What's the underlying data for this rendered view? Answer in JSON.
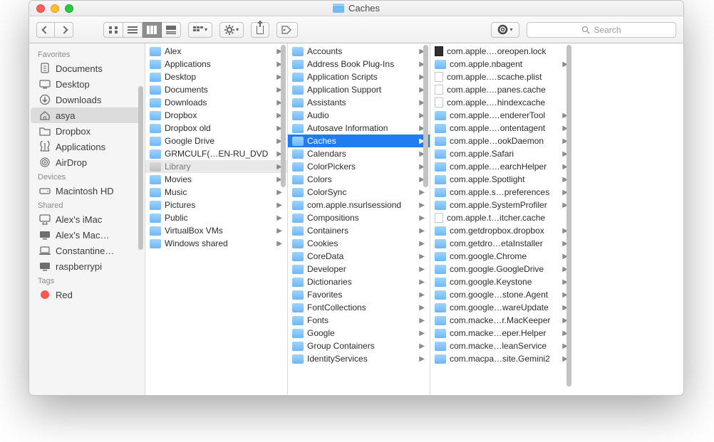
{
  "title": "Caches",
  "toolbar": {
    "search_placeholder": "Search"
  },
  "sidebar": {
    "sections": [
      {
        "title": "Favorites",
        "items": [
          {
            "label": "Documents",
            "icon": "doc"
          },
          {
            "label": "Desktop",
            "icon": "desktop"
          },
          {
            "label": "Downloads",
            "icon": "download"
          },
          {
            "label": "asya",
            "icon": "home",
            "selected": true
          },
          {
            "label": "Dropbox",
            "icon": "folder"
          },
          {
            "label": "Applications",
            "icon": "app"
          },
          {
            "label": "AirDrop",
            "icon": "airdrop"
          }
        ]
      },
      {
        "title": "Devices",
        "items": [
          {
            "label": "Macintosh HD",
            "icon": "hdd"
          }
        ]
      },
      {
        "title": "Shared",
        "items": [
          {
            "label": "Alex's iMac",
            "icon": "imac"
          },
          {
            "label": "Alex's Mac…",
            "icon": "display"
          },
          {
            "label": "Constantine…",
            "icon": "laptop"
          },
          {
            "label": "raspberrypi",
            "icon": "display"
          }
        ]
      },
      {
        "title": "Tags",
        "items": [
          {
            "label": "Red",
            "icon": "tag-red"
          }
        ]
      }
    ]
  },
  "columns": [
    {
      "items": [
        {
          "label": "Alex",
          "type": "folder",
          "arrow": true
        },
        {
          "label": "Applications",
          "type": "folder",
          "arrow": true
        },
        {
          "label": "Desktop",
          "type": "folder",
          "arrow": true
        },
        {
          "label": "Documents",
          "type": "folder",
          "arrow": true
        },
        {
          "label": "Downloads",
          "type": "folder",
          "arrow": true
        },
        {
          "label": "Dropbox",
          "type": "folder",
          "arrow": true
        },
        {
          "label": "Dropbox old",
          "type": "folder",
          "arrow": true
        },
        {
          "label": "Google Drive",
          "type": "folder",
          "arrow": true
        },
        {
          "label": "GRMCULF(…EN-RU_DVD",
          "type": "folder",
          "arrow": true
        },
        {
          "label": "Library",
          "type": "folder-dim",
          "arrow": true,
          "dim": true
        },
        {
          "label": "Movies",
          "type": "folder",
          "arrow": true
        },
        {
          "label": "Music",
          "type": "folder",
          "arrow": true
        },
        {
          "label": "Pictures",
          "type": "folder",
          "arrow": true
        },
        {
          "label": "Public",
          "type": "folder",
          "arrow": true
        },
        {
          "label": "VirtualBox VMs",
          "type": "folder",
          "arrow": true
        },
        {
          "label": "Windows shared",
          "type": "folder",
          "arrow": true
        }
      ]
    },
    {
      "items": [
        {
          "label": "Accounts",
          "type": "folder",
          "arrow": true
        },
        {
          "label": "Address Book Plug-Ins",
          "type": "folder",
          "arrow": true
        },
        {
          "label": "Application Scripts",
          "type": "folder",
          "arrow": true
        },
        {
          "label": "Application Support",
          "type": "folder",
          "arrow": true
        },
        {
          "label": "Assistants",
          "type": "folder",
          "arrow": true
        },
        {
          "label": "Audio",
          "type": "folder",
          "arrow": true
        },
        {
          "label": "Autosave Information",
          "type": "folder",
          "arrow": true
        },
        {
          "label": "Caches",
          "type": "folder",
          "arrow": true,
          "selected": true
        },
        {
          "label": "Calendars",
          "type": "folder",
          "arrow": true
        },
        {
          "label": "ColorPickers",
          "type": "folder",
          "arrow": true
        },
        {
          "label": "Colors",
          "type": "folder",
          "arrow": true
        },
        {
          "label": "ColorSync",
          "type": "folder",
          "arrow": true
        },
        {
          "label": "com.apple.nsurlsessiond",
          "type": "folder",
          "arrow": true
        },
        {
          "label": "Compositions",
          "type": "folder",
          "arrow": true
        },
        {
          "label": "Containers",
          "type": "folder",
          "arrow": true
        },
        {
          "label": "Cookies",
          "type": "folder",
          "arrow": true
        },
        {
          "label": "CoreData",
          "type": "folder",
          "arrow": true
        },
        {
          "label": "Developer",
          "type": "folder",
          "arrow": true
        },
        {
          "label": "Dictionaries",
          "type": "folder",
          "arrow": true
        },
        {
          "label": "Favorites",
          "type": "folder",
          "arrow": true
        },
        {
          "label": "FontCollections",
          "type": "folder",
          "arrow": true
        },
        {
          "label": "Fonts",
          "type": "folder",
          "arrow": true
        },
        {
          "label": "Google",
          "type": "folder",
          "arrow": true
        },
        {
          "label": "Group Containers",
          "type": "folder",
          "arrow": true
        },
        {
          "label": "IdentityServices",
          "type": "folder",
          "arrow": true
        }
      ]
    },
    {
      "items": [
        {
          "label": "com.apple.…oreopen.lock",
          "type": "file-black",
          "arrow": false
        },
        {
          "label": "com.apple.nbagent",
          "type": "folder",
          "arrow": true
        },
        {
          "label": "com.apple.…scache.plist",
          "type": "file",
          "arrow": false
        },
        {
          "label": "com.apple.…panes.cache",
          "type": "file",
          "arrow": false
        },
        {
          "label": "com.apple.…hindexcache",
          "type": "file",
          "arrow": false
        },
        {
          "label": "com.apple.…endererTool",
          "type": "folder",
          "arrow": true
        },
        {
          "label": "com.apple.…ontentagent",
          "type": "folder",
          "arrow": true
        },
        {
          "label": "com.apple…ookDaemon",
          "type": "folder",
          "arrow": true
        },
        {
          "label": "com.apple.Safari",
          "type": "folder",
          "arrow": true
        },
        {
          "label": "com.apple.…earchHelper",
          "type": "folder",
          "arrow": true
        },
        {
          "label": "com.apple.Spotlight",
          "type": "folder",
          "arrow": true
        },
        {
          "label": "com.apple.s…preferences",
          "type": "folder",
          "arrow": true
        },
        {
          "label": "com.apple.SystemProfiler",
          "type": "folder",
          "arrow": true
        },
        {
          "label": "com.apple.t…itcher.cache",
          "type": "file",
          "arrow": false
        },
        {
          "label": "com.getdropbox.dropbox",
          "type": "folder",
          "arrow": true
        },
        {
          "label": "com.getdro…etaInstaller",
          "type": "folder",
          "arrow": true
        },
        {
          "label": "com.google.Chrome",
          "type": "folder",
          "arrow": true
        },
        {
          "label": "com.google.GoogleDrive",
          "type": "folder",
          "arrow": true
        },
        {
          "label": "com.google.Keystone",
          "type": "folder",
          "arrow": true
        },
        {
          "label": "com.google…stone.Agent",
          "type": "folder",
          "arrow": true
        },
        {
          "label": "com.google…wareUpdate",
          "type": "folder",
          "arrow": true
        },
        {
          "label": "com.macke…r.MacKeeper",
          "type": "folder",
          "arrow": true
        },
        {
          "label": "com.macke…eper.Helper",
          "type": "folder",
          "arrow": true
        },
        {
          "label": "com.macke…leanService",
          "type": "folder",
          "arrow": true
        },
        {
          "label": "com.macpa…site.Gemini2",
          "type": "folder",
          "arrow": true
        }
      ]
    }
  ]
}
